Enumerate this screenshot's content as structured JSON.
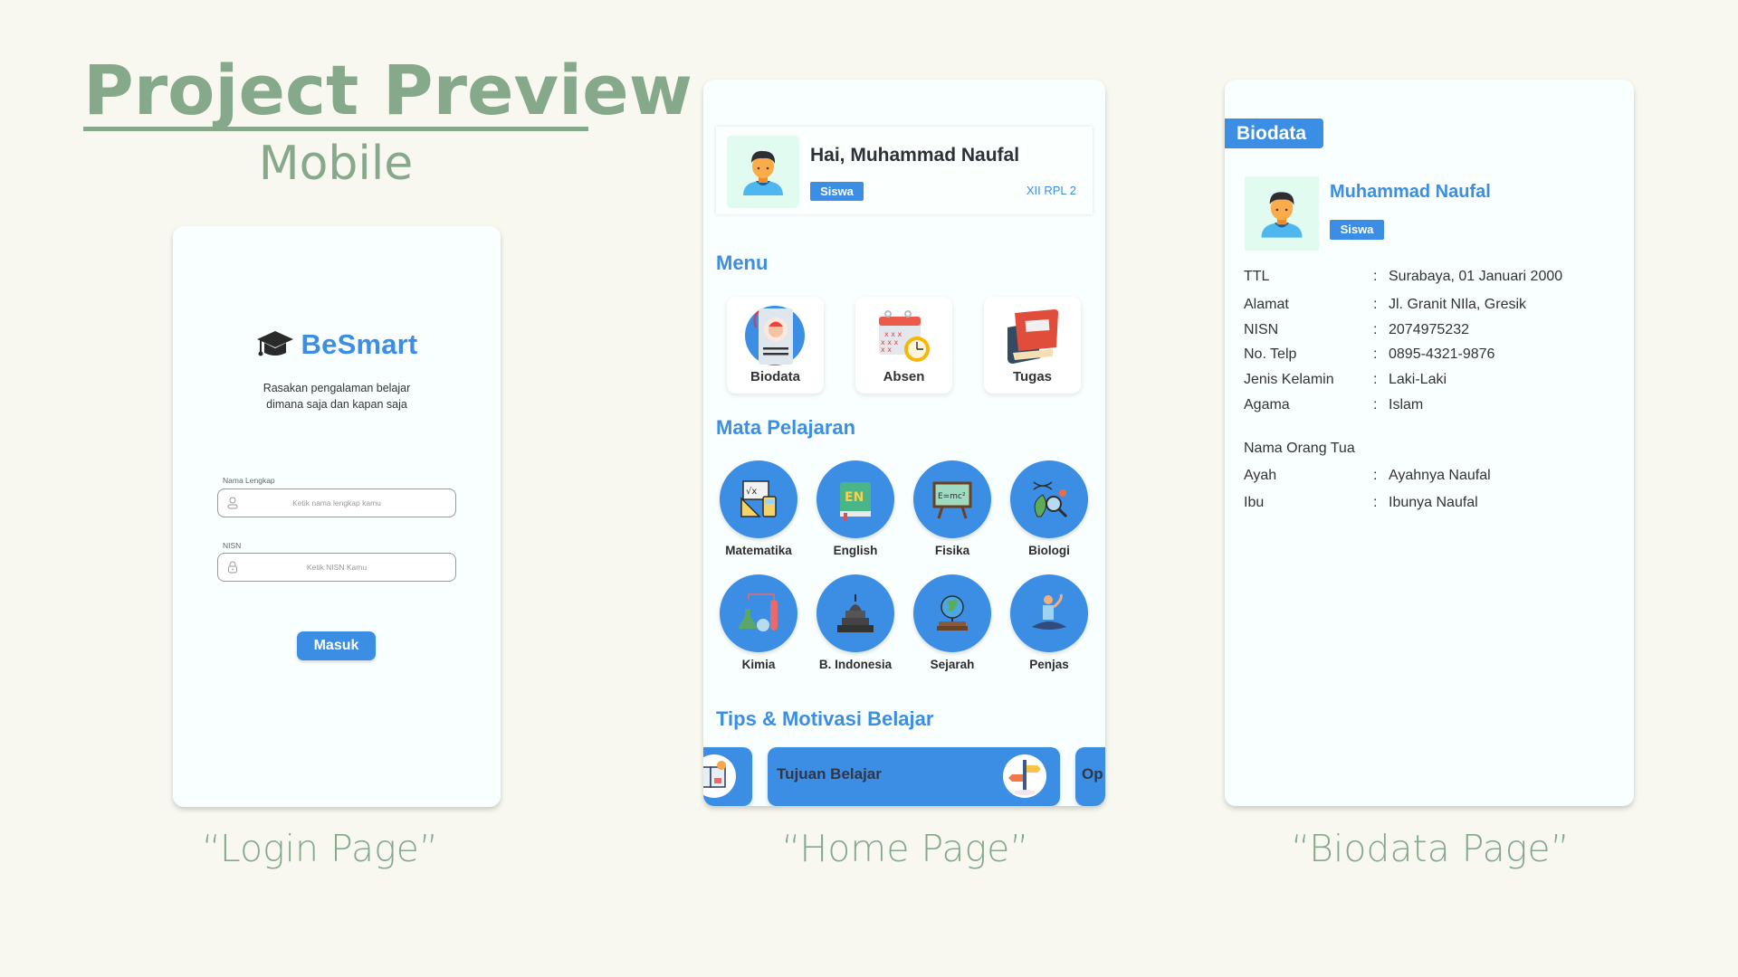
{
  "header": {
    "title": "Project Preview",
    "subtitle": "Mobile"
  },
  "colors": {
    "accent": "#3b8ee4",
    "heading_green": "#85a98a",
    "background": "#f8f8f1",
    "card": "#f9fffe",
    "avatar_bg": "#e1fbf1"
  },
  "captions": {
    "login": "“Login Page”",
    "home": "“Home Page”",
    "biodata": "“Biodata Page”"
  },
  "login": {
    "brand_icon": "graduation-cap-icon",
    "brand_name": "BeSmart",
    "tagline_line1": "Rasakan  pengalaman belajar",
    "tagline_line2": "dimana saja dan kapan saja",
    "fields": [
      {
        "label": "Nama Lengkap",
        "placeholder": "Ketik nama lengkap kamu",
        "value": "",
        "icon": "user-icon"
      },
      {
        "label": "NISN",
        "placeholder": "Ketik NISN Kamu",
        "value": "",
        "icon": "lock-icon"
      }
    ],
    "submit_label": "Masuk"
  },
  "home": {
    "greeting": "Hai, Muhammad Naufal",
    "role_badge": "Siswa",
    "class_name": "XII RPL 2",
    "menu_title": "Menu",
    "menu": [
      {
        "label": "Biodata",
        "icon": "id-card-icon"
      },
      {
        "label": "Absen",
        "icon": "calendar-clock-icon"
      },
      {
        "label": "Tugas",
        "icon": "books-icon"
      }
    ],
    "subjects_title": "Mata Pelajaran",
    "subjects": [
      {
        "label": "Matematika",
        "icon": "math-icon"
      },
      {
        "label": "English",
        "icon": "english-book-icon"
      },
      {
        "label": "Fisika",
        "icon": "physics-board-icon"
      },
      {
        "label": "Biologi",
        "icon": "biology-icon"
      },
      {
        "label": "Kimia",
        "icon": "chemistry-icon"
      },
      {
        "label": "B. Indonesia",
        "icon": "temple-icon"
      },
      {
        "label": "Sejarah",
        "icon": "globe-icon"
      },
      {
        "label": "Penjas",
        "icon": "yoga-icon"
      }
    ],
    "tips_title": "Tips & Motivasi Belajar",
    "tips": [
      {
        "label": "",
        "icon": "book-idea-icon"
      },
      {
        "label": "Tujuan Belajar",
        "icon": "signpost-icon"
      },
      {
        "label": "Op",
        "icon": ""
      }
    ]
  },
  "biodata": {
    "tab_label": "Biodata",
    "name": "Muhammad Naufal",
    "role_badge": "Siswa",
    "separator": ":",
    "fields": [
      {
        "key": "TTL",
        "value": "Surabaya, 01 Januari 2000"
      },
      {
        "key": "Alamat",
        "value": "Jl. Granit NIla, Gresik"
      },
      {
        "key": "NISN",
        "value": "2074975232"
      },
      {
        "key": "No. Telp",
        "value": "0895-4321-9876"
      },
      {
        "key": "Jenis Kelamin",
        "value": "Laki-Laki"
      },
      {
        "key": "Agama",
        "value": "Islam"
      }
    ],
    "parents_title": "Nama Orang Tua",
    "parents": [
      {
        "key": "Ayah",
        "value": "Ayahnya Naufal"
      },
      {
        "key": "Ibu",
        "value": "Ibunya Naufal"
      }
    ]
  }
}
